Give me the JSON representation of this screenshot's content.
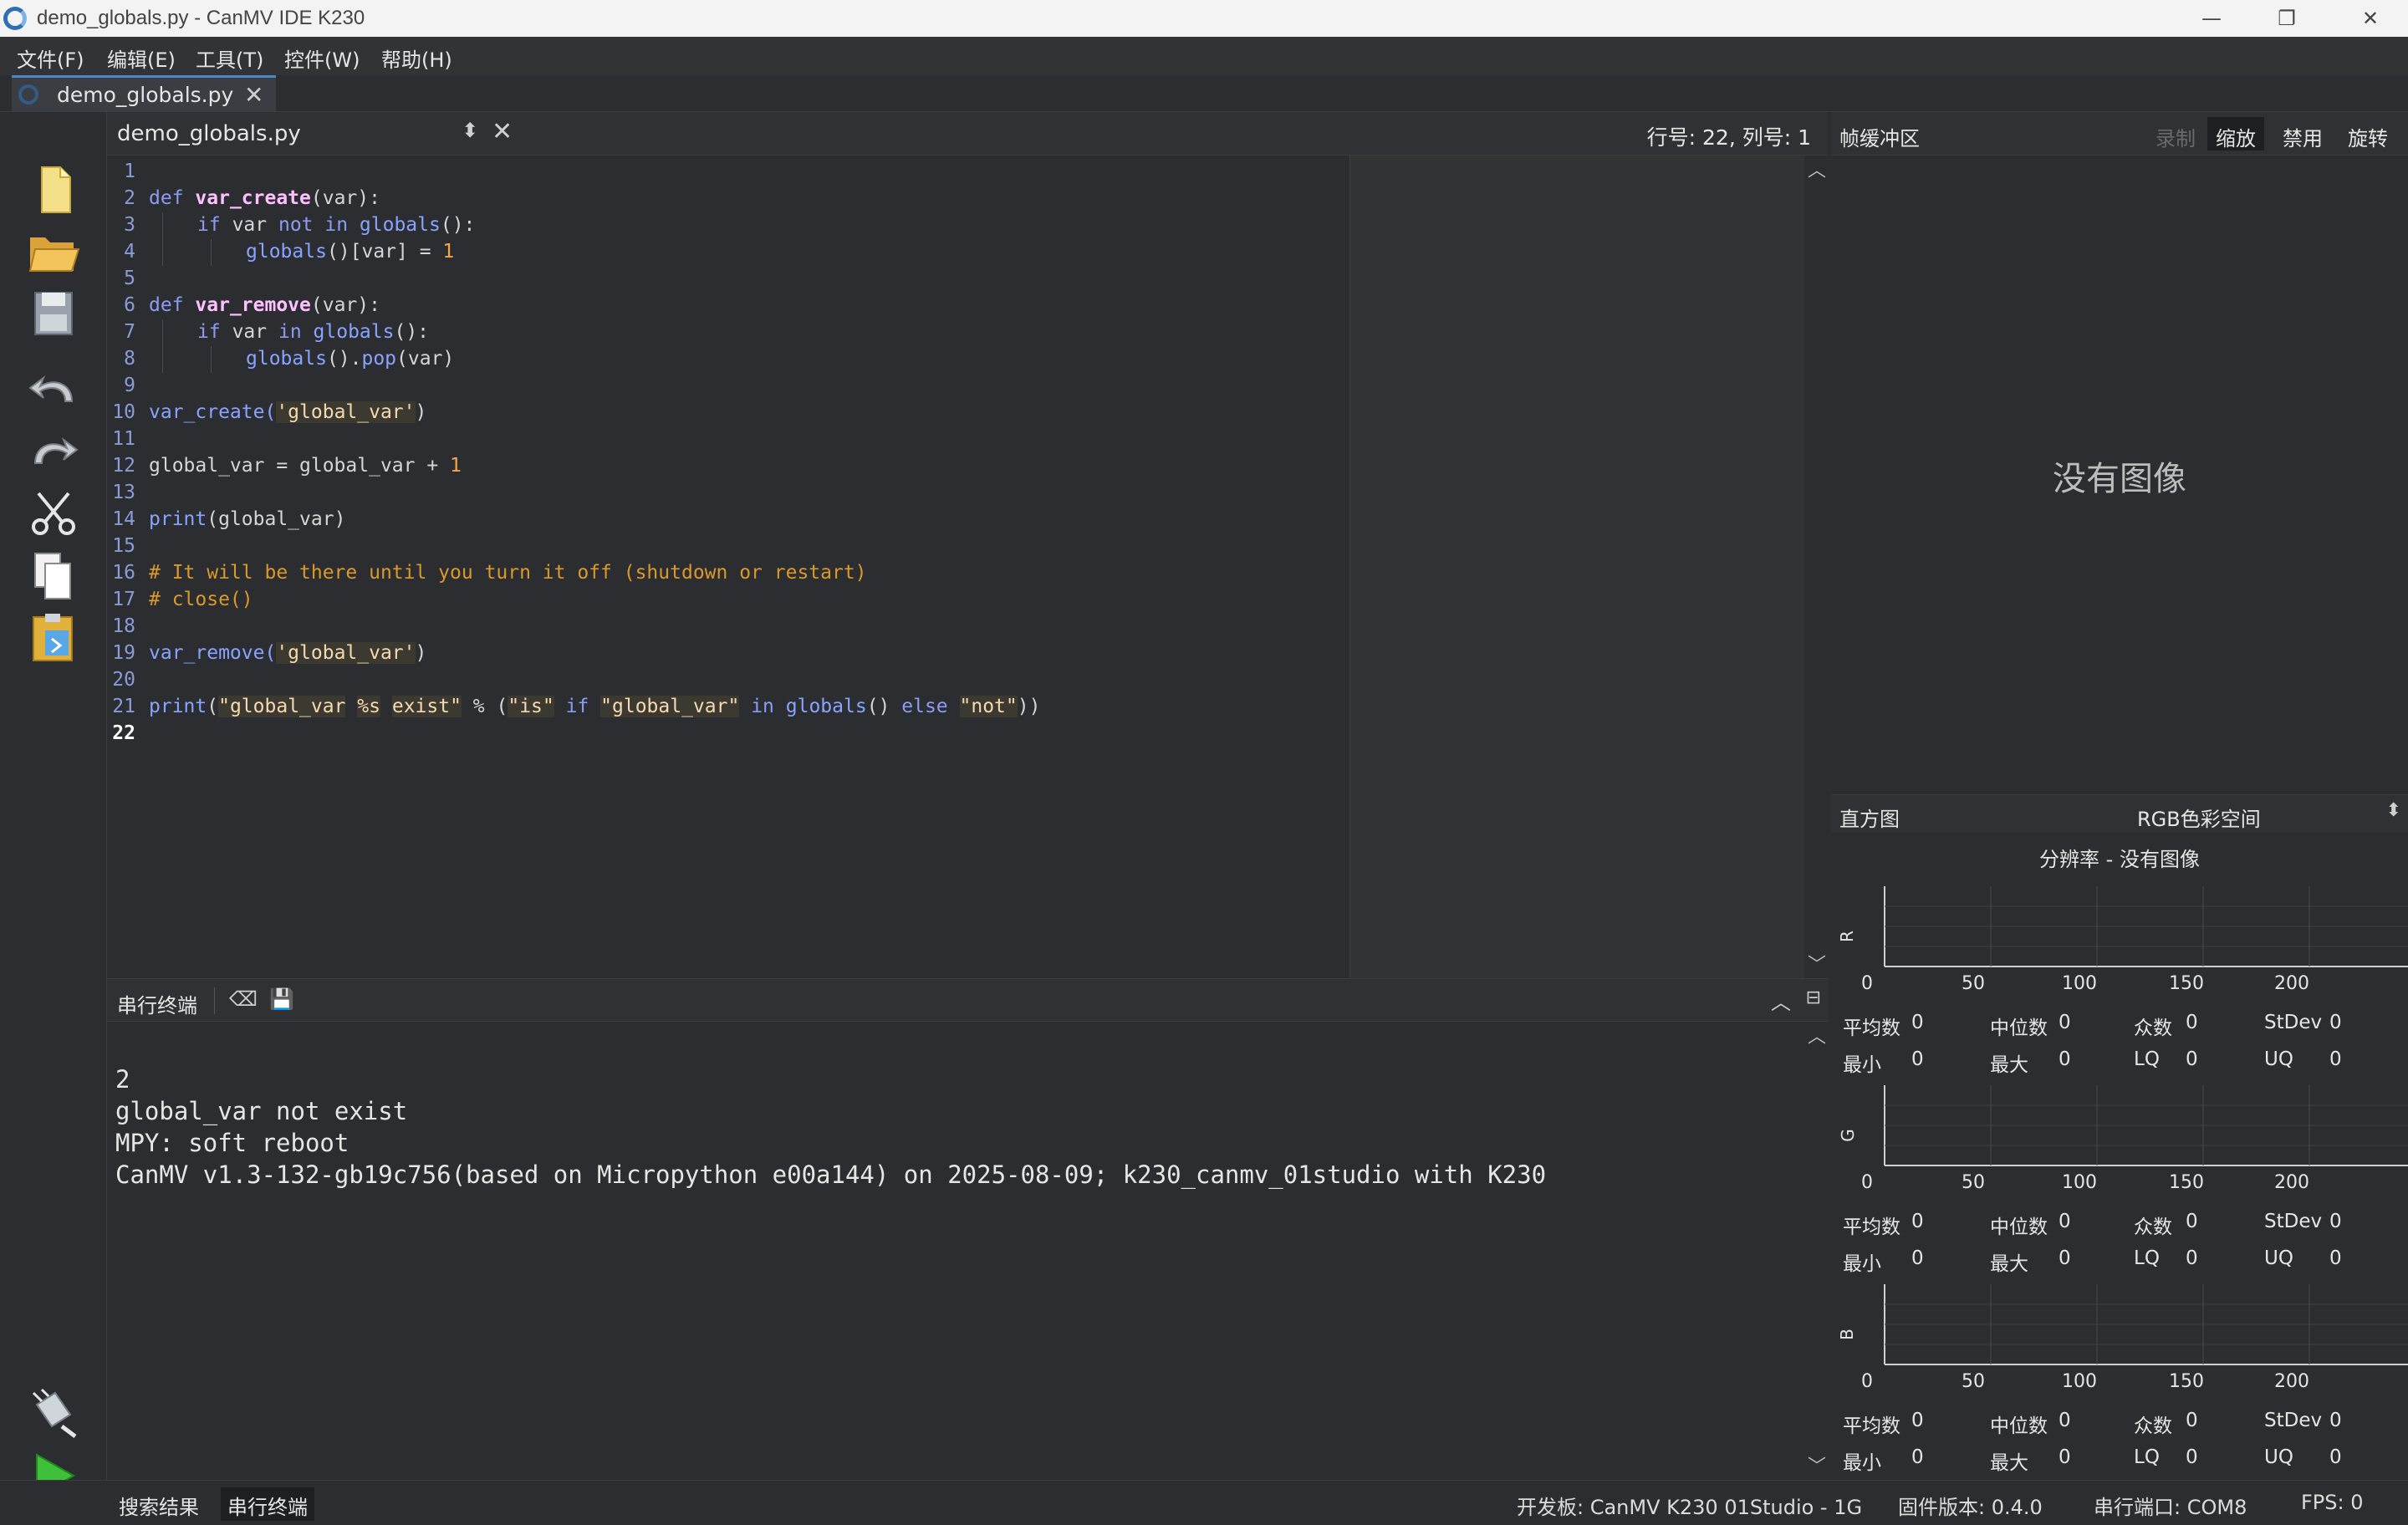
{
  "window": {
    "title": "demo_globals.py - CanMV IDE K230",
    "minimize": "—",
    "restore": "❐",
    "close": "✕"
  },
  "menu": [
    {
      "label": "文件(F)"
    },
    {
      "label": "编辑(E)"
    },
    {
      "label": "工具(T)"
    },
    {
      "label": "控件(W)"
    },
    {
      "label": "帮助(H)"
    }
  ],
  "file_tab": {
    "label": "demo_globals.py",
    "close": "✕"
  },
  "toolbar": {
    "items": [
      "new-file-icon",
      "open-folder-icon",
      "save-icon",
      "undo-icon",
      "redo-icon",
      "cut-icon",
      "copy-icon",
      "paste-icon",
      "connect-icon",
      "run-icon"
    ]
  },
  "editor": {
    "filename": "demo_globals.py",
    "sort_arrows": "⬍",
    "close": "✕",
    "cursor_pos": "行号: 22, 列号: 1",
    "scroll_up": "︿",
    "scroll_down": "﹀",
    "line_numbers": [
      "1",
      "2",
      "3",
      "4",
      "5",
      "6",
      "7",
      "8",
      "9",
      "10",
      "11",
      "12",
      "13",
      "14",
      "15",
      "16",
      "17",
      "18",
      "19",
      "20",
      "21",
      "22"
    ],
    "code": {
      "l2": {
        "kw": "def",
        "fn": "var_create",
        "rest": "(var):"
      },
      "l3": {
        "kw": "if",
        "mid": "var",
        "kw2": "not in",
        "bi": "globals",
        "rest": "():"
      },
      "l4": {
        "bi": "globals",
        "rest": "()[var] = ",
        "num": "1"
      },
      "l6": {
        "kw": "def",
        "fn": "var_remove",
        "rest": "(var):"
      },
      "l7": {
        "kw": "if",
        "mid": "var",
        "kw2": "in",
        "bi": "globals",
        "rest": "():"
      },
      "l8": {
        "bi": "globals",
        "rest": "().",
        "bi2": "pop",
        "rest2": "(var)"
      },
      "l10": {
        "pre": "var_create(",
        "str": "'global_var'",
        "post": ")"
      },
      "l12": {
        "pre": "global_var = global_var + ",
        "num": "1"
      },
      "l14": {
        "bi": "print",
        "rest": "(global_var)"
      },
      "l16": "# It will be there until you turn it off (shutdown or restart)",
      "l17": "# close()",
      "l19": {
        "pre": "var_remove(",
        "str": "'global_var'",
        "post": ")"
      },
      "l21": {
        "bi": "print",
        "p1": "(",
        "s1": "\"global_var",
        "s1b": "%s",
        "s1c": "exist\"",
        "p2": " % (",
        "s2": "\"is\"",
        "kw1": "if",
        "s3": "\"global_var\"",
        "kw2": "in",
        "bi2": "globals",
        "p3": "()",
        "kw3": "else",
        "s4": "\"not\"",
        "p4": "))"
      }
    }
  },
  "terminal": {
    "label": "串行终端",
    "clear_icon": "⌫",
    "save_icon": "💾",
    "collapse_icon": "︿",
    "float_icon": "⊟",
    "scroll_up": "︿",
    "scroll_down": "﹀",
    "lines": [
      "2",
      "global_var not exist",
      "MPY: soft reboot",
      "CanMV v1.3-132-gb19c756(based on Micropython e00a144) on 2025-08-09; k230_canmv_01studio with K230"
    ]
  },
  "statusbar": {
    "tabs": [
      {
        "label": "搜索结果",
        "active": false
      },
      {
        "label": "串行终端",
        "active": true
      }
    ],
    "board": "开发板:  CanMV K230 01Studio - 1G",
    "firmware": "固件版本:  0.4.0",
    "port": "串行端口:  COM8",
    "fps": "FPS:  0"
  },
  "framebuffer": {
    "label": "帧缓冲区",
    "buttons": [
      {
        "label": "录制",
        "enabled": false,
        "active": false
      },
      {
        "label": "缩放",
        "enabled": true,
        "active": true
      },
      {
        "label": "禁用",
        "enabled": true,
        "active": false
      },
      {
        "label": "旋转",
        "enabled": true,
        "active": false
      }
    ],
    "no_image": "没有图像"
  },
  "histogram": {
    "label": "直方图",
    "colorspace": "RGB色彩空间",
    "colorspace_arrow": "⬍",
    "resolution": "分辨率 - 没有图像",
    "ticks": [
      "0",
      "50",
      "100",
      "150",
      "200"
    ],
    "channels": [
      {
        "name": "R",
        "mean_label": "平均数",
        "mean": "0",
        "median_label": "中位数",
        "median": "0",
        "mode_label": "众数",
        "mode": "0",
        "stdev_label": "StDev",
        "stdev": "0",
        "min_label": "最小",
        "min": "0",
        "max_label": "最大",
        "max": "0",
        "lq_label": "LQ",
        "lq": "0",
        "uq_label": "UQ",
        "uq": "0"
      },
      {
        "name": "G",
        "mean_label": "平均数",
        "mean": "0",
        "median_label": "中位数",
        "median": "0",
        "mode_label": "众数",
        "mode": "0",
        "stdev_label": "StDev",
        "stdev": "0",
        "min_label": "最小",
        "min": "0",
        "max_label": "最大",
        "max": "0",
        "lq_label": "LQ",
        "lq": "0",
        "uq_label": "UQ",
        "uq": "0"
      },
      {
        "name": "B",
        "mean_label": "平均数",
        "mean": "0",
        "median_label": "中位数",
        "median": "0",
        "mode_label": "众数",
        "mode": "0",
        "stdev_label": "StDev",
        "stdev": "0",
        "min_label": "最小",
        "min": "0",
        "max_label": "最大",
        "max": "0",
        "lq_label": "LQ",
        "lq": "0",
        "uq_label": "UQ",
        "uq": "0"
      }
    ]
  }
}
